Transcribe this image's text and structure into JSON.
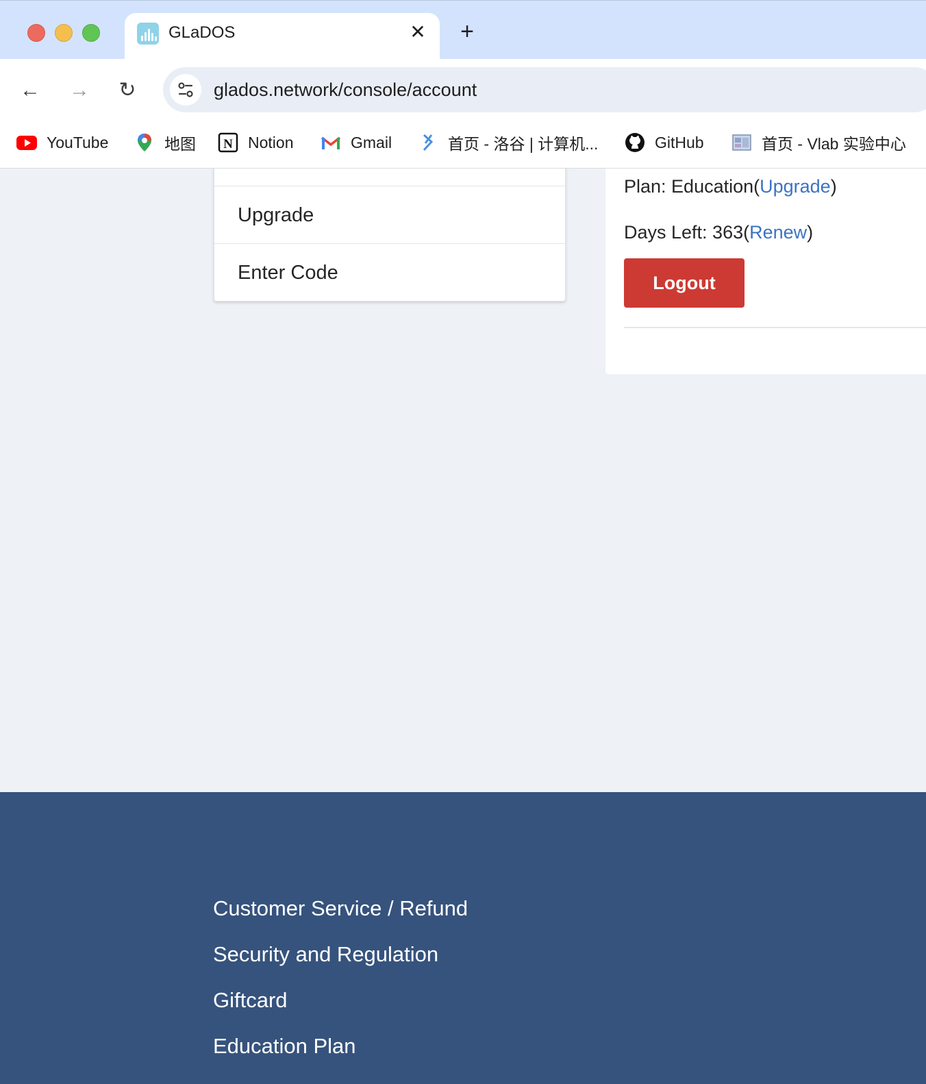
{
  "browser": {
    "tab_title": "GLaDOS",
    "tab_close": "✕",
    "new_tab": "+",
    "url": "glados.network/console/account",
    "nav": {
      "back": "←",
      "forward": "→",
      "reload": "↻"
    },
    "bookmarks": [
      {
        "label": "YouTube",
        "icon": "youtube-icon"
      },
      {
        "label": "地图",
        "icon": "maps-pin-icon"
      },
      {
        "label": "Notion",
        "icon": "notion-icon"
      },
      {
        "label": "Gmail",
        "icon": "gmail-icon"
      },
      {
        "label": "首页 - 洛谷 | 计算机...",
        "icon": "luogu-icon"
      },
      {
        "label": "GitHub",
        "icon": "github-icon"
      },
      {
        "label": "首页 - Vlab 实验中心",
        "icon": "vlab-icon"
      }
    ]
  },
  "menu": {
    "items": [
      {
        "label": "Upgrade"
      },
      {
        "label": "Enter Code"
      }
    ]
  },
  "account": {
    "plan_prefix": "Plan: Education(",
    "plan_link": "Upgrade",
    "plan_suffix": ")",
    "days_prefix": "Days Left: 363(",
    "days_link": "Renew",
    "days_suffix": ")",
    "logout_label": "Logout"
  },
  "footer": {
    "links": [
      {
        "label": "Customer Service / Refund"
      },
      {
        "label": "Security and Regulation"
      },
      {
        "label": "Giftcard"
      },
      {
        "label": "Education Plan"
      }
    ]
  },
  "colors": {
    "titlebar": "#d3e3fd",
    "page_bg": "#eef1f6",
    "link": "#3b73c4",
    "logout": "#cc3a33",
    "footer": "#36537d"
  }
}
